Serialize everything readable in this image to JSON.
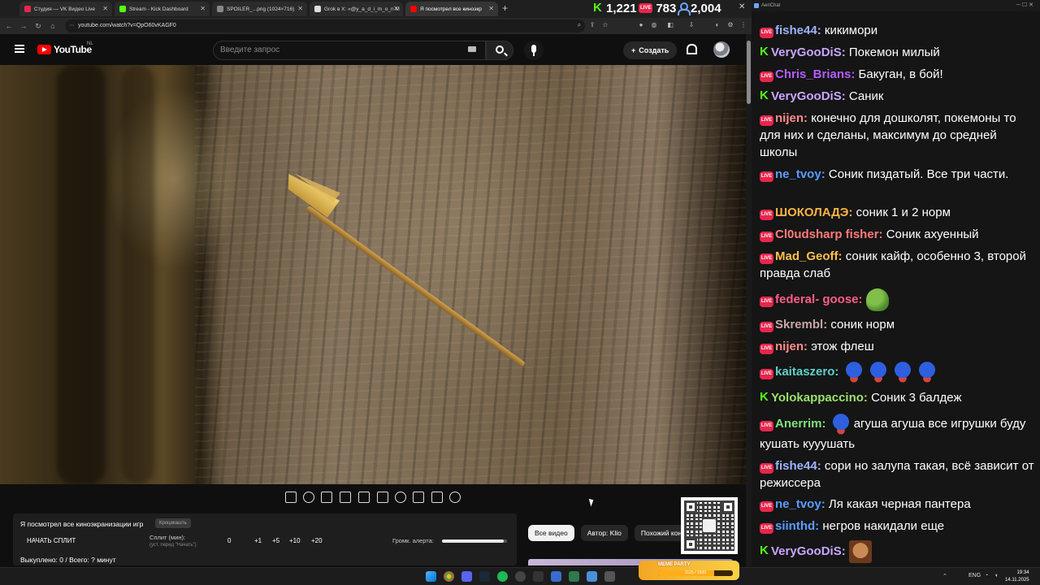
{
  "browser": {
    "tabs": [
      {
        "label": "Студия — VK Видео Live",
        "favicon_color": "#e8264b"
      },
      {
        "label": "Stream - Kick Dashboard",
        "favicon_color": "#53fc18"
      },
      {
        "label": "SPOILER_...png (1024×716)",
        "favicon_color": "#888888"
      },
      {
        "label": "Grok в X: «@y_a_d_i_m_o_n М",
        "favicon_color": "#dddddd"
      },
      {
        "label": "Я посмотрел все киноэкр",
        "favicon_color": "#ff0000"
      }
    ],
    "active_tab": 4,
    "url": "youtube.com/watch?v=QpO60vKAGF0"
  },
  "counters": {
    "kick": "1,221",
    "vk": "783",
    "total": "2,004",
    "vk_badge": "LIVE"
  },
  "youtube": {
    "logo_text": "YouTube",
    "region": "NL",
    "search_placeholder": "Введите запрос",
    "create_label": "Создать",
    "chips": [
      "Все видео",
      "Автор: Klio",
      "Похожий кон"
    ]
  },
  "widget": {
    "title": "Я посмотрел все киноэкранизации игр",
    "badge": "Кроцикашть",
    "start_label": "НАЧАТЬ СПЛИТ",
    "split_label": "Сплит (мин):",
    "split_sub": "(уст. перед \"Начать\")",
    "split_values": [
      "0",
      "+1",
      "+5",
      "+10",
      "+20"
    ],
    "volume_label": "Громк. алерта:",
    "volume_fraction": 0.95,
    "bought": "Выкуплено: 0 / Всего: ? минут"
  },
  "chat": {
    "window_title": "AeriChat",
    "messages": [
      {
        "platform": "vk",
        "nick": "fishe44",
        "color": "#9cb4ff",
        "text": "кикимори"
      },
      {
        "platform": "kick",
        "nick": "VeryGooDiS",
        "color": "#c9a5ff",
        "text": "Покемон милый"
      },
      {
        "platform": "vk",
        "nick": "Chris_Brians",
        "color": "#b45cff",
        "text": "Бакуган, в бой!"
      },
      {
        "platform": "kick",
        "nick": "VeryGooDiS",
        "color": "#c9a5ff",
        "text": "Саник"
      },
      {
        "platform": "vk",
        "nick": "nijen",
        "color": "#ff8a8a",
        "text": "конечно для дошколят, покемоны то для них и сделаны, максимум до средней школы"
      },
      {
        "platform": "vk",
        "nick": "ne_tvoy",
        "color": "#5a9cff",
        "text": "Соник пиздатый. Все три части."
      },
      {
        "platform": "vk",
        "nick": "ШОКОЛАДЭ",
        "color": "#ffb347",
        "text": "соник 1 и 2 норм"
      },
      {
        "platform": "vk",
        "nick": "Cl0udsharp fisher",
        "color": "#ff7a7a",
        "text": "Соник ахуенный"
      },
      {
        "platform": "vk",
        "nick": "Mad_Geoff",
        "color": "#ffc04d",
        "text": "соник кайф, особенно 3, второй правда слаб"
      },
      {
        "platform": "vk",
        "nick": "federal- goose",
        "color": "#ff5c8a",
        "text": ""
      },
      {
        "platform": "vk",
        "nick": "Skrembl",
        "color": "#c9a5a5",
        "text": "соник норм"
      },
      {
        "platform": "vk",
        "nick": "nijen",
        "color": "#ff8a8a",
        "text": "этож флеш"
      },
      {
        "platform": "vk",
        "nick": "kaitaszero",
        "color": "#5fd1c9",
        "text": ""
      },
      {
        "platform": "kick",
        "nick": "Yolokappaccino",
        "color": "#9be36d",
        "text": "Соник 3 балдеж"
      },
      {
        "platform": "vk",
        "nick": "Anerrim",
        "color": "#7ee07e",
        "text": "агуша агуша все игрушки буду кушать кууушать"
      },
      {
        "platform": "vk",
        "nick": "fishe44",
        "color": "#9cb4ff",
        "text": "сори но залупа такая, всё зависит от режиссера"
      },
      {
        "platform": "vk",
        "nick": "ne_tvoy",
        "color": "#5a9cff",
        "text": "Ля какая черная пантера"
      },
      {
        "platform": "vk",
        "nick": "siinthd",
        "color": "#5a9cff",
        "text": "негров накидали еще"
      },
      {
        "platform": "kick",
        "nick": "VeryGooDiS",
        "color": "#c9a5ff",
        "text": ""
      }
    ]
  },
  "taskbar": {
    "lang": "ENG",
    "time": "19:34",
    "date": "14.11.2025",
    "meme_label": "MEME PARTY",
    "meme_progress_text": "1125 / 1500",
    "meme_fraction": 0.75
  }
}
